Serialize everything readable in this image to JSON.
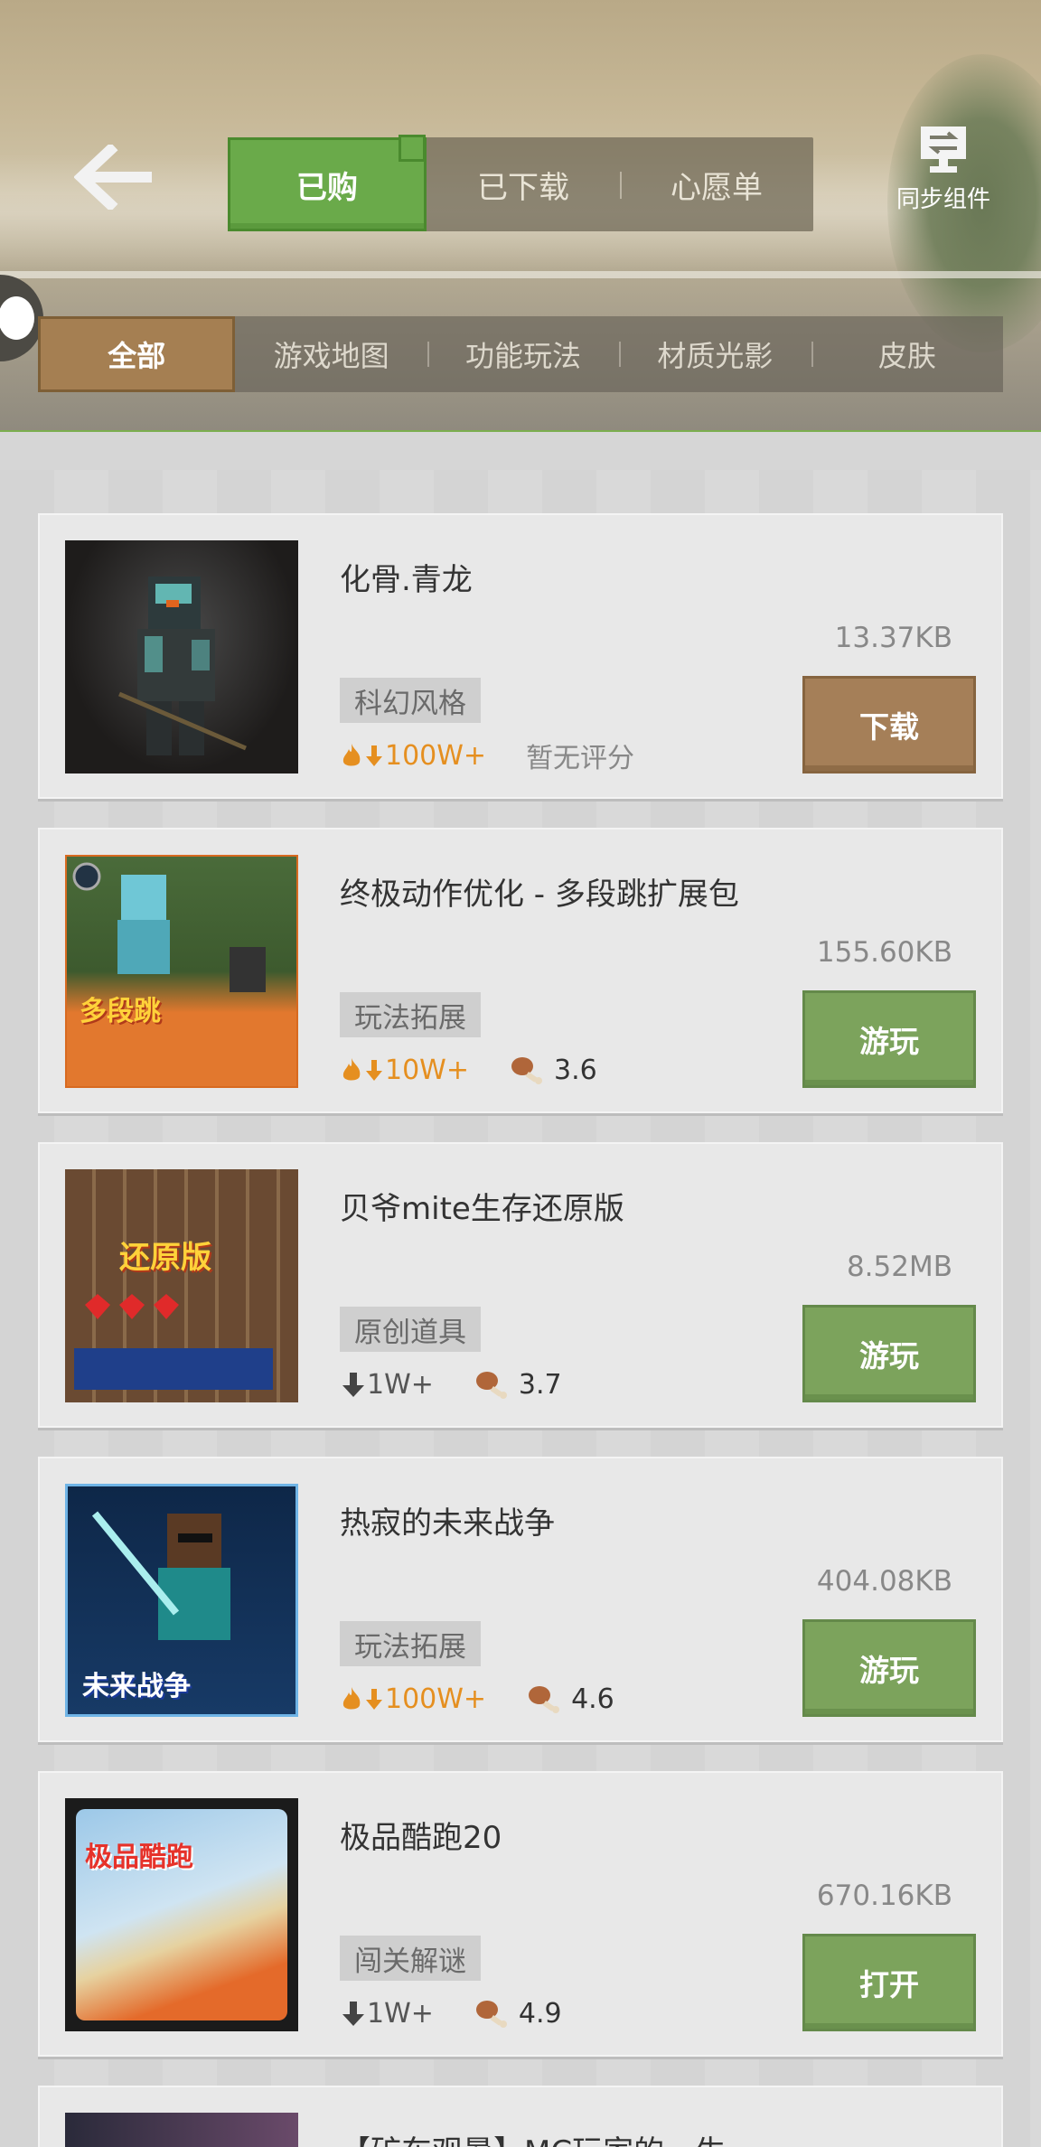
{
  "header": {
    "top_tabs": [
      "已购",
      "已下载",
      "心愿单"
    ],
    "active_top_tab": "已购",
    "sync_label": "同步组件",
    "categories": [
      "全部",
      "游戏地图",
      "功能玩法",
      "材质光影",
      "皮肤"
    ],
    "active_category": "全部"
  },
  "colors": {
    "accent_green": "#7cae4f",
    "button_green": "#7ca35c",
    "button_brown": "#a57f58",
    "hot_orange": "#e58f20"
  },
  "items": [
    {
      "title": "化骨.青龙",
      "size": "13.37KB",
      "tag": "科幻风格",
      "downloads": "100W+",
      "hot": true,
      "rating": "暂无评分",
      "has_rating": false,
      "action": "下载",
      "action_style": "brown",
      "thumb_text": ""
    },
    {
      "title": "终极动作优化 - 多段跳扩展包",
      "size": "155.60KB",
      "tag": "玩法拓展",
      "downloads": "10W+",
      "hot": true,
      "rating": "3.6",
      "has_rating": true,
      "action": "游玩",
      "action_style": "green",
      "thumb_text": "多段跳"
    },
    {
      "title": "贝爷mite生存还原版",
      "size": "8.52MB",
      "tag": "原创道具",
      "downloads": "1W+",
      "hot": false,
      "rating": "3.7",
      "has_rating": true,
      "action": "游玩",
      "action_style": "green",
      "thumb_text": "还原版"
    },
    {
      "title": "热寂的未来战争",
      "size": "404.08KB",
      "tag": "玩法拓展",
      "downloads": "100W+",
      "hot": true,
      "rating": "4.6",
      "has_rating": true,
      "action": "游玩",
      "action_style": "green",
      "thumb_text": "未来战争"
    },
    {
      "title": "极品酷跑20",
      "size": "670.16KB",
      "tag": "闯关解谜",
      "downloads": "1W+",
      "hot": false,
      "rating": "4.9",
      "has_rating": true,
      "action": "打开",
      "action_style": "green",
      "thumb_text": "极品酷跑"
    }
  ],
  "partial_item": {
    "title": "【矿车观暑】MC玩家的一生"
  }
}
